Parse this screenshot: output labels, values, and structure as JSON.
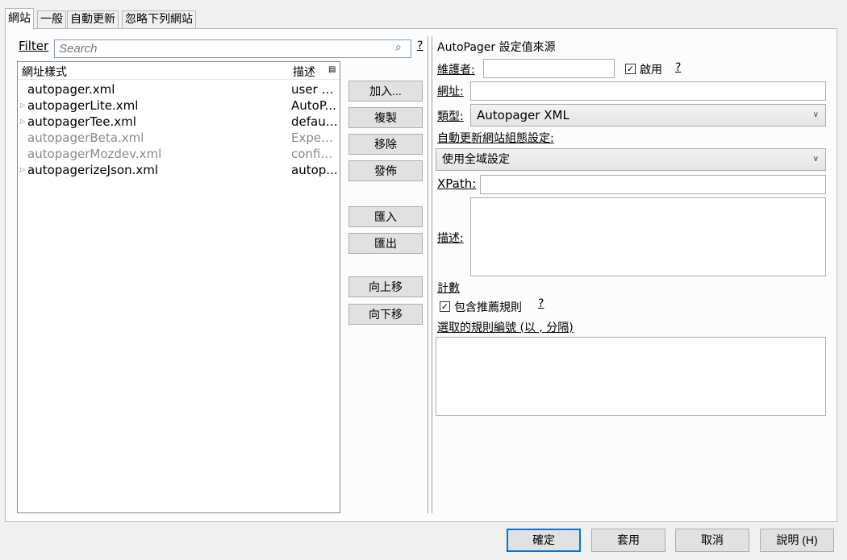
{
  "tabs": [
    "網站",
    "一般",
    "自動更新",
    "忽略下列網站"
  ],
  "filter": {
    "label": "Filter",
    "placeholder": "Search",
    "help": "?"
  },
  "list": {
    "columns": [
      "網址樣式",
      "描述"
    ],
    "rows": [
      {
        "name": "autopager.xml",
        "desc": "user c...",
        "expandable": false,
        "enabled": true
      },
      {
        "name": "autopagerLite.xml",
        "desc": "AutoP...",
        "expandable": true,
        "enabled": true
      },
      {
        "name": "autopagerTee.xml",
        "desc": "defaul...",
        "expandable": true,
        "enabled": true
      },
      {
        "name": "autopagerBeta.xml",
        "desc": "Experi...",
        "expandable": false,
        "enabled": false
      },
      {
        "name": "autopagerMozdev.xml",
        "desc": "config...",
        "expandable": false,
        "enabled": false
      },
      {
        "name": "autopagerizeJson.xml",
        "desc": "autop...",
        "expandable": true,
        "enabled": true
      }
    ]
  },
  "buttons": {
    "add": "加入...",
    "copy": "複製",
    "remove": "移除",
    "publish": "發佈",
    "import": "匯入",
    "export": "匯出",
    "up": "向上移",
    "down": "向下移"
  },
  "details": {
    "title": "AutoPager 設定值來源",
    "maintainer_label": "維護者:",
    "maintainer_value": "",
    "enabled_label": "啟用",
    "enabled": true,
    "help": "?",
    "url_label": "網址:",
    "url_value": "",
    "type_label": "類型:",
    "type_value": "Autopager XML",
    "autoupdate_label": "自動更新網站組態設定:",
    "autoupdate_value": "使用全域設定",
    "xpath_label": "XPath:",
    "xpath_value": "",
    "desc_label": "描述:",
    "desc_value": "",
    "count_label": "計數",
    "include_label": "包含推薦規則",
    "include_checked": true,
    "selected_label": "選取的規則編號 (以 , 分隔)",
    "selected_value": ""
  },
  "footer": {
    "ok": "確定",
    "apply": "套用",
    "cancel": "取消",
    "help": "說明 (H)"
  }
}
